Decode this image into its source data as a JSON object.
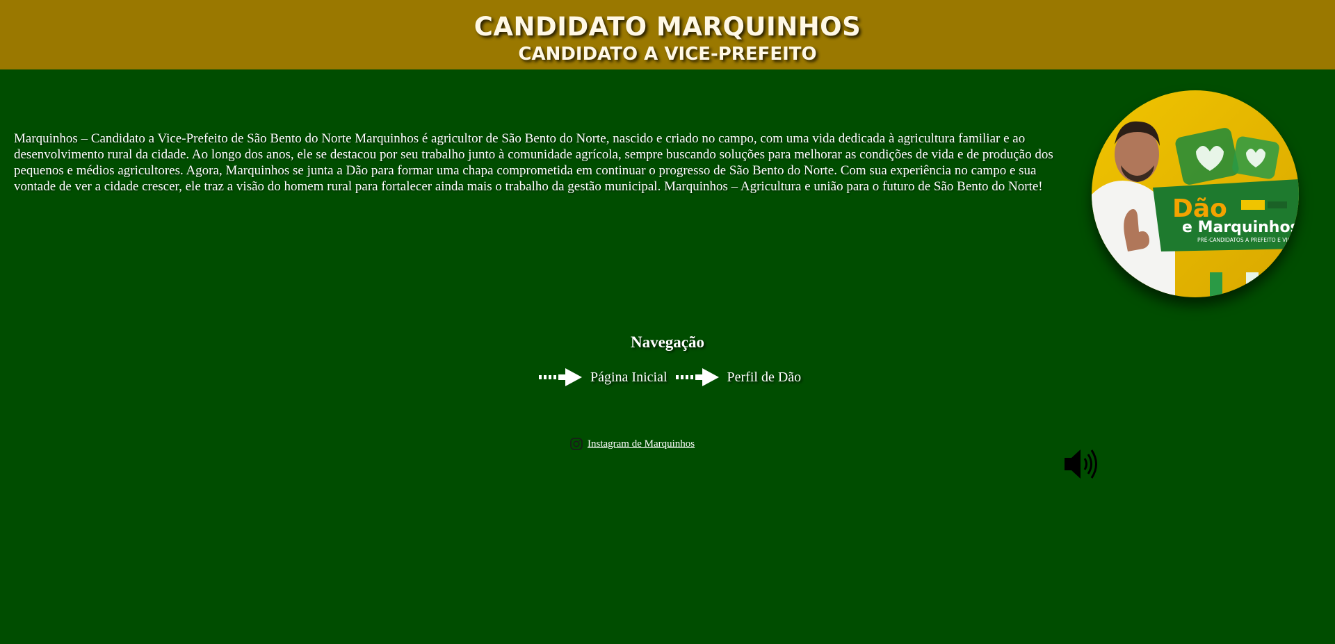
{
  "header": {
    "title": "CANDIDATO MARQUINHOS",
    "subtitle": "CANDIDATO A VICE-PREFEITO"
  },
  "bio": {
    "text": "Marquinhos – Candidato a Vice-Prefeito de São Bento do Norte Marquinhos é agricultor de São Bento do Norte, nascido e criado no campo, com uma vida dedicada à agricultura familiar e ao desenvolvimento rural da cidade. Ao longo dos anos, ele se destacou por seu trabalho junto à comunidade agrícola, sempre buscando soluções para melhorar as condições de vida e de produção dos pequenos e médios agricultores. Agora, Marquinhos se junta a Dão para formar uma chapa comprometida em continuar o progresso de São Bento do Norte. Com sua experiência no campo e sua vontade de ver a cidade crescer, ele traz a visão do homem rural para fortalecer ainda mais o trabalho da gestão municipal. Marquinhos – Agricultura e união para o futuro de São Bento do Norte!"
  },
  "portrait": {
    "brand_top": "Dão",
    "brand_bottom": "e Marquinhos",
    "tagline": "PRÉ-CANDIDATOS A PREFEITO E VICE",
    "colors": {
      "yellow": "#e8b800",
      "green": "#1e7a2e",
      "brand_orange": "#f4a300"
    }
  },
  "navigation": {
    "title": "Navegação",
    "links": [
      {
        "label": "Página Inicial",
        "icon": "dashed-arrow-right-icon"
      },
      {
        "label": "Perfil de Dão",
        "icon": "dashed-arrow-right-icon"
      }
    ]
  },
  "social": {
    "instagram_label": "Instagram de Marquinhos",
    "icon": "instagram-icon"
  },
  "audio": {
    "icon": "speaker-icon"
  },
  "colors": {
    "background": "#004d00",
    "header": "#9a7800",
    "text": "#ffffff"
  }
}
